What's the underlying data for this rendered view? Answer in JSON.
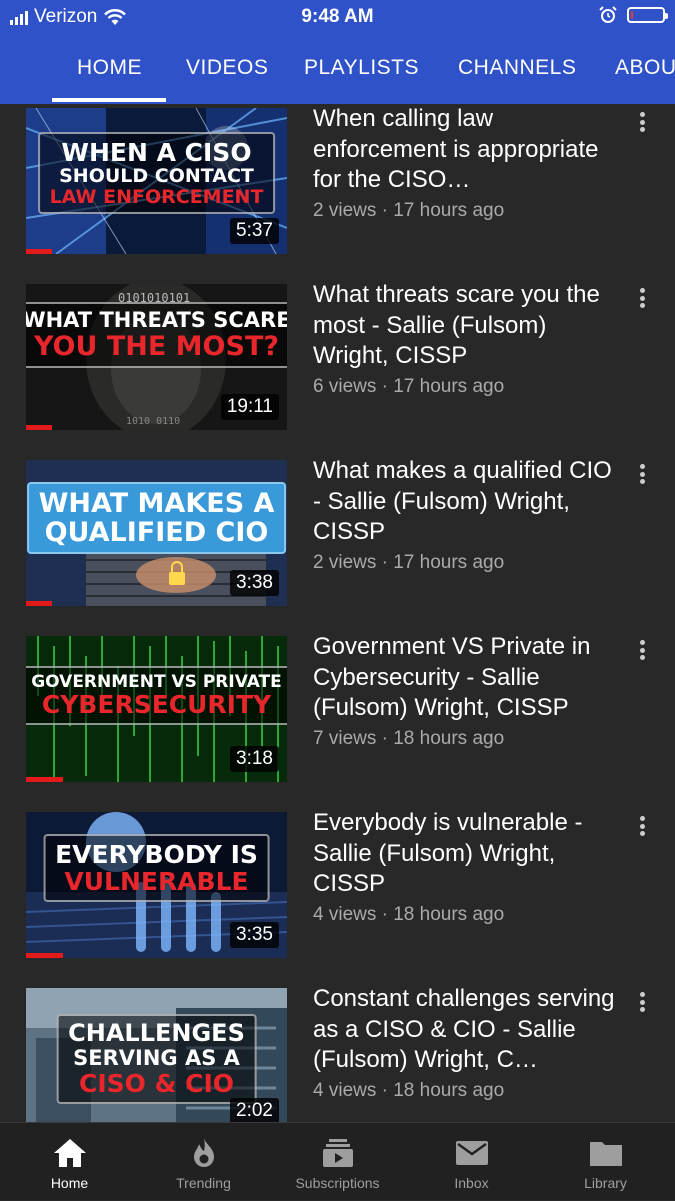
{
  "status_bar": {
    "carrier": "Verizon",
    "time": "9:48 AM",
    "battery_level": 0.08
  },
  "tabs": [
    "HOME",
    "VIDEOS",
    "PLAYLISTS",
    "CHANNELS",
    "ABOUT"
  ],
  "active_tab": "HOME",
  "videos": [
    {
      "thumb_line1": "WHEN A CISO",
      "thumb_line2": "SHOULD CONTACT",
      "thumb_line3": "LAW ENFORCEMENT",
      "duration": "5:37",
      "watched": 0.1,
      "title": "When calling law enforcement is appropriate for the CISO…",
      "meta": "2 views · 17 hours ago"
    },
    {
      "thumb_line1": "WHAT THREATS SCARE",
      "thumb_line2": "YOU THE MOST?",
      "duration": "19:11",
      "watched": 0.1,
      "title": "What threats scare you the most - Sallie (Fulsom) Wright, CISSP",
      "meta": "6 views · 17 hours ago"
    },
    {
      "thumb_line1": "WHAT MAKES A",
      "thumb_line2": "QUALIFIED CIO",
      "duration": "3:38",
      "watched": 0.1,
      "title": "What makes a qualified CIO - Sallie (Fulsom) Wright, CISSP",
      "meta": "2 views · 17 hours ago"
    },
    {
      "thumb_line1": "GOVERNMENT VS PRIVATE",
      "thumb_line2": "CYBERSECURITY",
      "duration": "3:18",
      "watched": 0.14,
      "title": "Government VS Private in Cybersecurity  - Sallie (Fulsom) Wright, CISSP",
      "meta": "7 views · 18 hours ago"
    },
    {
      "thumb_line1": "EVERYBODY IS",
      "thumb_line2": "VULNERABLE",
      "duration": "3:35",
      "watched": 0.14,
      "title": "Everybody is vulnerable - Sallie (Fulsom) Wright, CISSP",
      "meta": "4 views · 18 hours ago"
    },
    {
      "thumb_line1": "CHALLENGES",
      "thumb_line2": "SERVING AS A",
      "thumb_line3": "CISO & CIO",
      "duration": "2:02",
      "watched": 0,
      "title": "Constant challenges serving as a CISO & CIO - Sallie (Fulsom) Wright, C…",
      "meta": "4 views · 18 hours ago"
    }
  ],
  "bottom_nav": [
    {
      "label": "Home",
      "icon": "home-icon",
      "active": true
    },
    {
      "label": "Trending",
      "icon": "flame-icon",
      "active": false
    },
    {
      "label": "Subscriptions",
      "icon": "subscriptions-icon",
      "active": false
    },
    {
      "label": "Inbox",
      "icon": "mail-icon",
      "active": false
    },
    {
      "label": "Library",
      "icon": "folder-icon",
      "active": false
    }
  ],
  "colors": {
    "header": "#2f52c8",
    "background": "#282828",
    "progress": "#e21a1a",
    "accent_red": "#e8262b"
  }
}
